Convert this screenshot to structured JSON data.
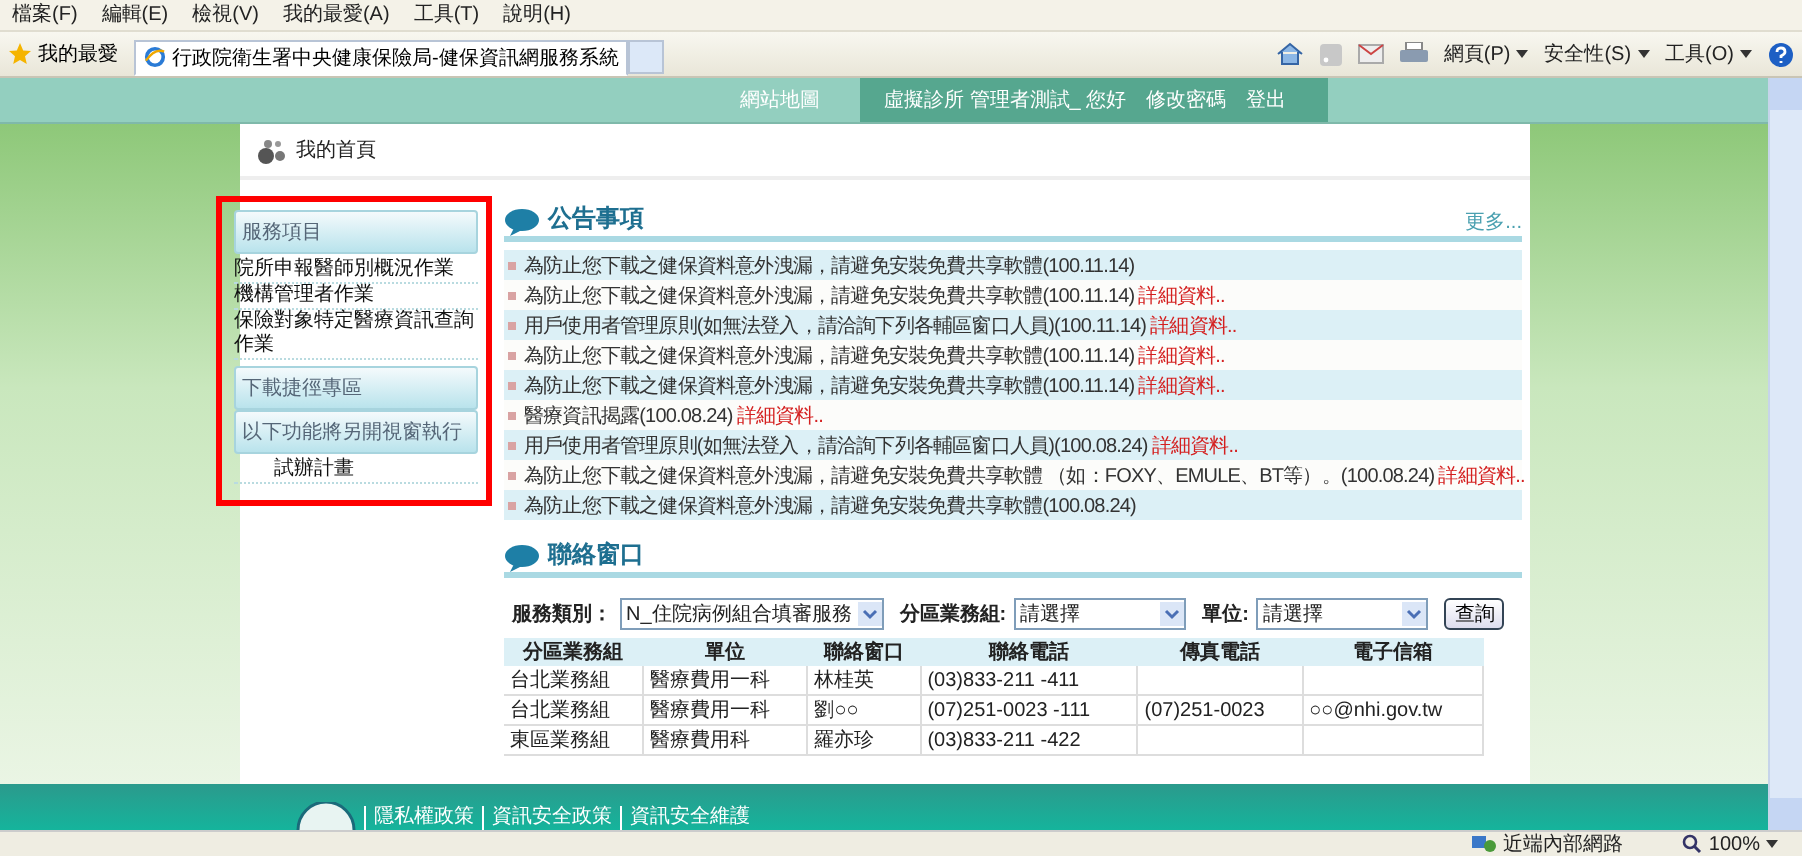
{
  "menu_bar": [
    "檔案(F)",
    "編輯(E)",
    "檢視(V)",
    "我的最愛(A)",
    "工具(T)",
    "說明(H)"
  ],
  "favorites": {
    "label": "我的最愛"
  },
  "tabs": [
    {
      "label": "行政院衛生署中央健康保險局-健保資訊網服務系統",
      "selected": true
    }
  ],
  "command_bar": [
    "網頁(P)",
    "安全性(S)",
    "工具(O)"
  ],
  "site_header": {
    "sitemap": "網站地圖",
    "user": "虛擬診所 管理者測試_ 您好",
    "links": [
      "修改密碼",
      "登出"
    ]
  },
  "page_title": "我的首頁",
  "sidebar": [
    {
      "title": "服務項目",
      "items": [
        "院所申報醫師別概況作業",
        "機構管理者作業",
        "保險對象特定醫療資訊查詢作業"
      ]
    },
    {
      "title": "下載捷徑專區"
    },
    {
      "title": "以下功能將另開視窗執行",
      "items": [
        "試辦計畫"
      ]
    }
  ],
  "announcements": {
    "title": "公告事項",
    "more": "更多...",
    "items": [
      {
        "text": "為防止您下載之健保資料意外洩漏，請避免安裝免費共享軟體",
        "date": "(100.11.14)"
      },
      {
        "text": "為防止您下載之健保資料意外洩漏，請避免安裝免費共享軟體",
        "date": "(100.11.14)",
        "detail": "詳細資料.."
      },
      {
        "text": "用戶使用者管理原則(如無法登入，請洽詢下列各輔區窗口人員)",
        "date": "(100.11.14)",
        "detail": "詳細資料.."
      },
      {
        "text": "為防止您下載之健保資料意外洩漏，請避免安裝免費共享軟體",
        "date": "(100.11.14)",
        "detail": "詳細資料.."
      },
      {
        "text": "為防止您下載之健保資料意外洩漏，請避免安裝免費共享軟體",
        "date": "(100.11.14)",
        "detail": "詳細資料.."
      },
      {
        "text": "醫療資訊揭露",
        "date": "(100.08.24)",
        "detail": "詳細資料.."
      },
      {
        "text": "用戶使用者管理原則(如無法登入，請洽詢下列各輔區窗口人員)",
        "date": "(100.08.24)",
        "detail": "詳細資料.."
      },
      {
        "text": "為防止您下載之健保資料意外洩漏，請避免安裝免費共享軟體 （如：FOXY、EMULE、BT等）。",
        "date": "(100.08.24)",
        "detail": "詳細資料.."
      },
      {
        "text": "為防止您下載之健保資料意外洩漏，請避免安裝免費共享軟體",
        "date": "(100.08.24)"
      }
    ]
  },
  "contacts": {
    "title": "聯絡窗口",
    "filters": [
      {
        "label": "服務類別：",
        "value": "N_住院病例組合填審服務"
      },
      {
        "label": "分區業務組:",
        "value": "請選擇"
      },
      {
        "label": "單位:",
        "value": "請選擇"
      }
    ],
    "search_button": "查詢",
    "columns": [
      "分區業務組",
      "單位",
      "聯絡窗口",
      "聯絡電話",
      "傳真電話",
      "電子信箱"
    ],
    "rows": [
      {
        "region": "台北業務組",
        "unit": "醫療費用一科",
        "contact": "林桂英",
        "phone": "(03)833-211 -411"
      },
      {
        "region": "台北業務組",
        "unit": "醫療費用一科",
        "contact": "劉○○",
        "phone": "(07)251-0023 -111",
        "fax": "(07)251-0023",
        "email": "○○@nhi.gov.tw"
      },
      {
        "region": "東區業務組",
        "unit": "醫療費用科",
        "contact": "羅亦珍",
        "phone": "(03)833-211 -422"
      }
    ]
  },
  "footer": {
    "links": [
      "隱私權政策",
      "資訊安全政策",
      "資訊安全維護"
    ]
  },
  "status_bar": {
    "zone": "近端內部網路",
    "zoom": "100%"
  }
}
